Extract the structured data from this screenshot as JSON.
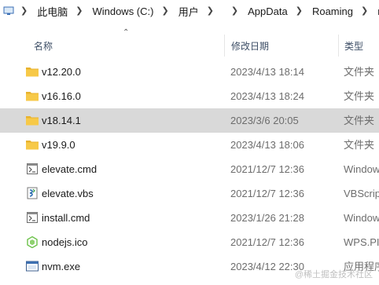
{
  "address_bar": {
    "crumbs": [
      "此电脑",
      "Windows (C:)",
      "用户",
      "",
      "AppData",
      "Roaming",
      "nvm"
    ]
  },
  "columns": {
    "name": "名称",
    "date": "修改日期",
    "type": "类型"
  },
  "files": [
    {
      "name": "v12.20.0",
      "date": "2023/4/13 18:14",
      "type": "文件夹",
      "icon": "folder-icon"
    },
    {
      "name": "v16.16.0",
      "date": "2023/4/13 18:24",
      "type": "文件夹",
      "icon": "folder-icon"
    },
    {
      "name": "v18.14.1",
      "date": "2023/3/6 20:05",
      "type": "文件夹",
      "icon": "folder-icon",
      "selected": true
    },
    {
      "name": "v19.9.0",
      "date": "2023/4/13 18:06",
      "type": "文件夹",
      "icon": "folder-icon"
    },
    {
      "name": "elevate.cmd",
      "date": "2021/12/7 12:36",
      "type": "Window",
      "icon": "cmd-file-icon"
    },
    {
      "name": "elevate.vbs",
      "date": "2021/12/7 12:36",
      "type": "VBScrip",
      "icon": "vbs-file-icon"
    },
    {
      "name": "install.cmd",
      "date": "2023/1/26 21:28",
      "type": "Window",
      "icon": "cmd-file-icon"
    },
    {
      "name": "nodejs.ico",
      "date": "2021/12/7 12:36",
      "type": "WPS.PIC",
      "icon": "ico-file-icon"
    },
    {
      "name": "nvm.exe",
      "date": "2023/4/12 22:30",
      "type": "应用程序",
      "icon": "exe-file-icon"
    }
  ],
  "watermark": "@稀土掘金技术社区",
  "colors": {
    "folder": "#f7c948",
    "selection": "#d9d9d9",
    "header_text": "#3d4e66",
    "muted_text": "#6d6d6d"
  }
}
